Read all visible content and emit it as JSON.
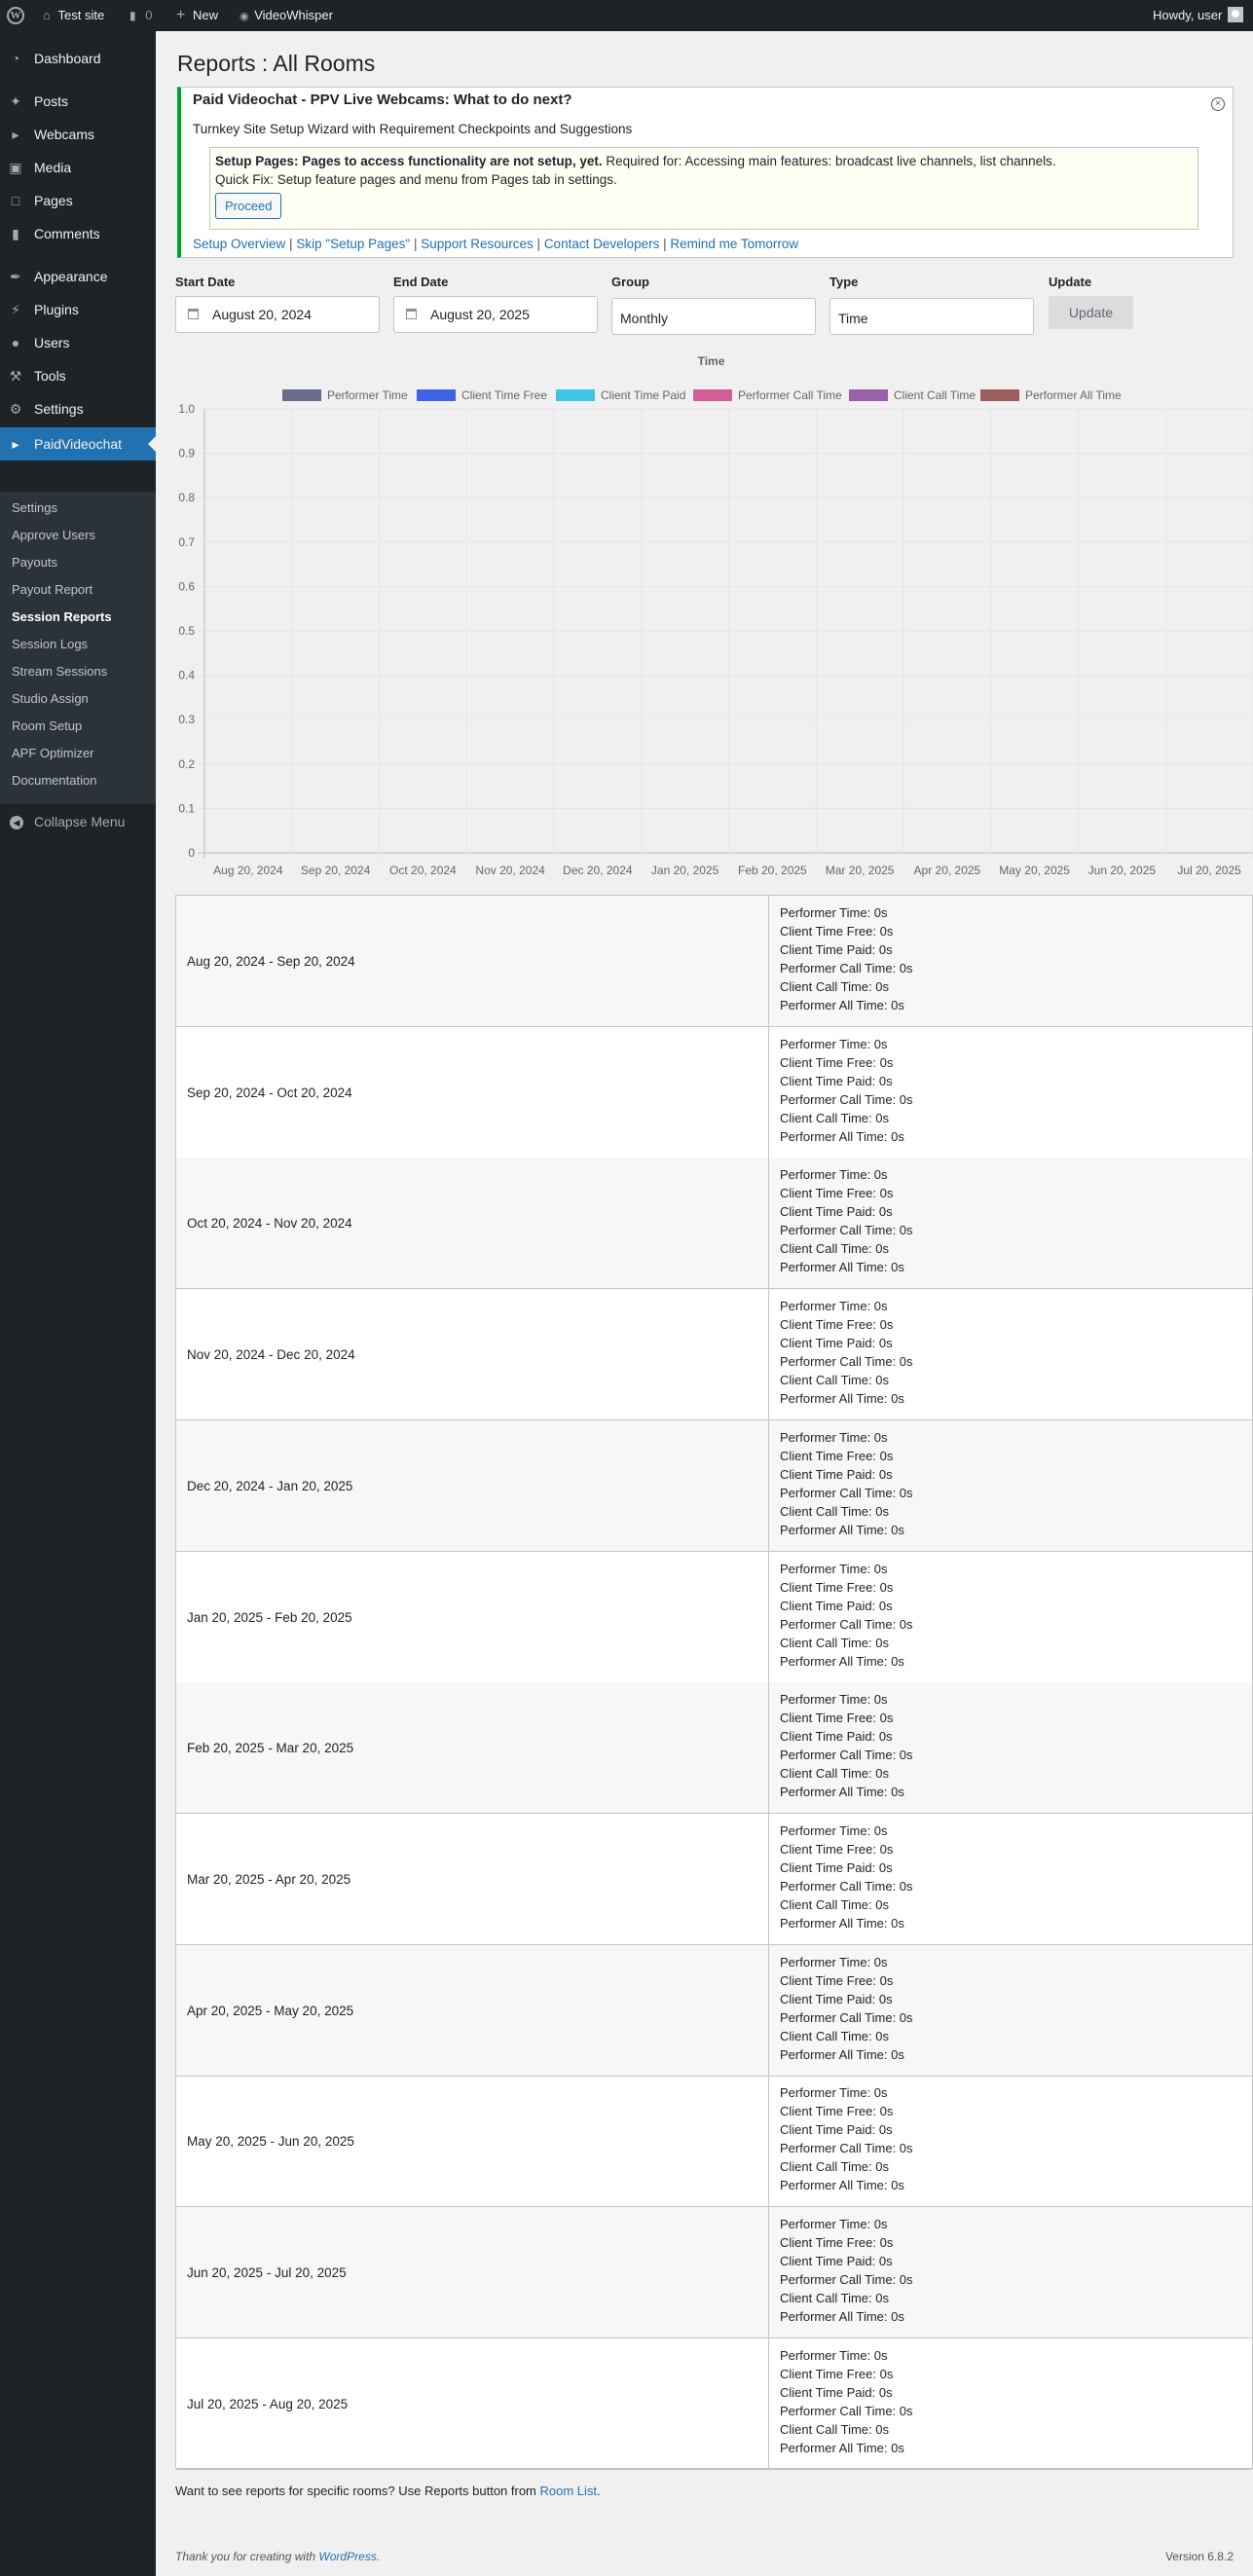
{
  "adminbar": {
    "wp_logo": "W",
    "site_name": "Test site",
    "comments_count": "0",
    "new_label": "New",
    "plugin_label": "VideoWhisper",
    "howdy": "Howdy, user"
  },
  "sidebar": {
    "items": [
      {
        "label": "Dashboard",
        "icon": "dashboard-icon"
      },
      {
        "label": "Posts",
        "icon": "pin-icon"
      },
      {
        "label": "Webcams",
        "icon": "video-icon"
      },
      {
        "label": "Media",
        "icon": "media-icon"
      },
      {
        "label": "Pages",
        "icon": "page-icon"
      },
      {
        "label": "Comments",
        "icon": "comment-icon"
      },
      {
        "label": "Appearance",
        "icon": "brush-icon"
      },
      {
        "label": "Plugins",
        "icon": "plugin-icon"
      },
      {
        "label": "Users",
        "icon": "user-icon"
      },
      {
        "label": "Tools",
        "icon": "wrench-icon"
      },
      {
        "label": "Settings",
        "icon": "settings-icon"
      },
      {
        "label": "PaidVideochat",
        "icon": "video-icon"
      }
    ],
    "submenu": [
      "Settings",
      "Approve Users",
      "Payouts",
      "Payout Report",
      "Session Reports",
      "Session Logs",
      "Stream Sessions",
      "Studio Assign",
      "Room Setup",
      "APF Optimizer",
      "Documentation"
    ],
    "collapse_label": "Collapse Menu"
  },
  "page": {
    "title": "Reports : All Rooms"
  },
  "notice": {
    "title": "Paid Videochat - PPV Live Webcams: What to do next?",
    "subtitle": "Turnkey Site Setup Wizard with Requirement Checkpoints and Suggestions",
    "setup_bold": "Setup Pages: Pages to access functionality are not setup, yet.",
    "setup_text": " Required for: Accessing main features: broadcast live channels, list channels.",
    "quick_fix": "Quick Fix: Setup feature pages and menu from Pages tab in settings.",
    "proceed": "Proceed",
    "links": [
      "Setup Overview",
      "Skip \"Setup Pages\"",
      "Support Resources",
      "Contact Developers",
      "Remind me Tomorrow"
    ]
  },
  "filters": {
    "start_label": "Start Date",
    "start_value": "August 20, 2024",
    "end_label": "End Date",
    "end_value": "August 20, 2025",
    "group_label": "Group",
    "group_value": "Monthly",
    "type_label": "Type",
    "type_value": "Time",
    "update_label": "Update",
    "update_button": "Update"
  },
  "chart_data": {
    "type": "bar",
    "title": "Time",
    "ylim": [
      0,
      1
    ],
    "yticks": [
      "0",
      "0.1",
      "0.2",
      "0.3",
      "0.4",
      "0.5",
      "0.6",
      "0.7",
      "0.8",
      "0.9",
      "1.0"
    ],
    "categories": [
      "Aug 20, 2024",
      "Sep 20, 2024",
      "Oct 20, 2024",
      "Nov 20, 2024",
      "Dec 20, 2024",
      "Jan 20, 2025",
      "Feb 20, 2025",
      "Mar 20, 2025",
      "Apr 20, 2025",
      "May 20, 2025",
      "Jun 20, 2025",
      "Jul 20, 2025"
    ],
    "legend_position": "top",
    "grid": true,
    "series": [
      {
        "name": "Performer Time",
        "color": "#6b6b8a",
        "values": [
          0,
          0,
          0,
          0,
          0,
          0,
          0,
          0,
          0,
          0,
          0,
          0
        ]
      },
      {
        "name": "Client Time Free",
        "color": "#3e63e6",
        "values": [
          0,
          0,
          0,
          0,
          0,
          0,
          0,
          0,
          0,
          0,
          0,
          0
        ]
      },
      {
        "name": "Client Time Paid",
        "color": "#3ec5e6",
        "values": [
          0,
          0,
          0,
          0,
          0,
          0,
          0,
          0,
          0,
          0,
          0,
          0
        ]
      },
      {
        "name": "Performer Call Time",
        "color": "#d35e96",
        "values": [
          0,
          0,
          0,
          0,
          0,
          0,
          0,
          0,
          0,
          0,
          0,
          0
        ]
      },
      {
        "name": "Client Call Time",
        "color": "#9a60a8",
        "values": [
          0,
          0,
          0,
          0,
          0,
          0,
          0,
          0,
          0,
          0,
          0,
          0
        ]
      },
      {
        "name": "Performer All Time",
        "color": "#9c5e5e",
        "values": [
          0,
          0,
          0,
          0,
          0,
          0,
          0,
          0,
          0,
          0,
          0,
          0
        ]
      }
    ]
  },
  "report_rows": [
    {
      "period": "Aug 20, 2024 - Sep 20, 2024"
    },
    {
      "period": "Sep 20, 2024 - Oct 20, 2024"
    },
    {
      "period": "Oct 20, 2024 - Nov 20, 2024"
    },
    {
      "period": "Nov 20, 2024 - Dec 20, 2024"
    },
    {
      "period": "Dec 20, 2024 - Jan 20, 2025"
    },
    {
      "period": "Jan 20, 2025 - Feb 20, 2025"
    },
    {
      "period": "Feb 20, 2025 - Mar 20, 2025"
    },
    {
      "period": "Mar 20, 2025 - Apr 20, 2025"
    },
    {
      "period": "Apr 20, 2025 - May 20, 2025"
    },
    {
      "period": "May 20, 2025 - Jun 20, 2025"
    },
    {
      "period": "Jun 20, 2025 - Jul 20, 2025"
    },
    {
      "period": "Jul 20, 2025 - Aug 20, 2025"
    }
  ],
  "report_stat_lines": [
    "Performer Time: 0s",
    "Client Time Free: 0s",
    "Client Time Paid: 0s",
    "Performer Call Time: 0s",
    "Client Call Time: 0s",
    "Performer All Time: 0s"
  ],
  "footer": {
    "note_text": "Want to see reports for specific rooms? Use Reports button from ",
    "note_link": "Room List",
    "note_end": ".",
    "thanks_text": "Thank you for creating with ",
    "thanks_link": "WordPress",
    "thanks_end": ".",
    "version": "Version 6.8.2"
  }
}
